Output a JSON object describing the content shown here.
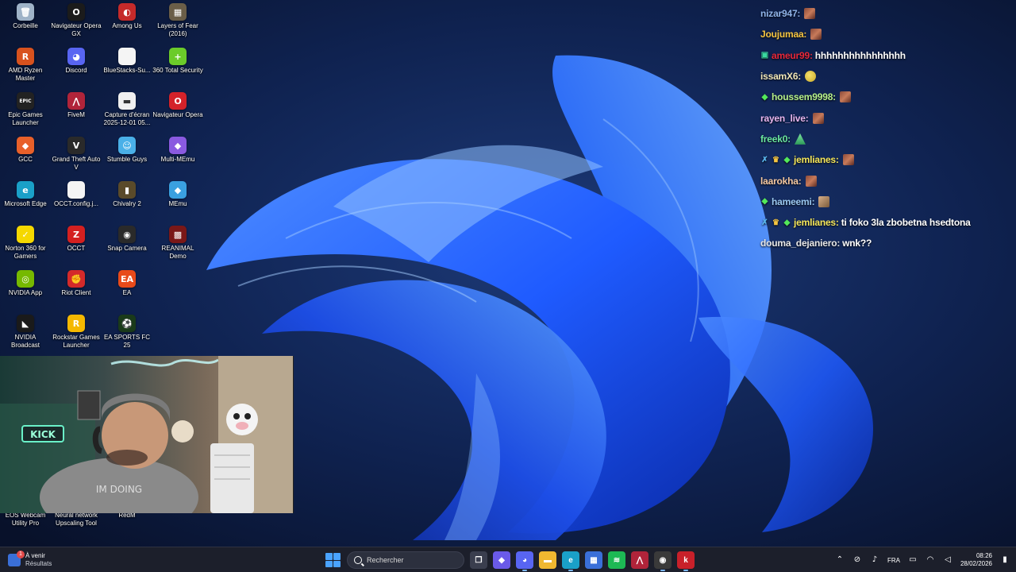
{
  "desktop_icons": [
    {
      "label": "Corbeille",
      "icon": "recycle-bin-icon",
      "color": "#9fb3c8",
      "glyph": "🗑"
    },
    {
      "label": "Navigateur Opera GX",
      "icon": "opera-gx-icon",
      "color": "#1b1b1b",
      "glyph": "O"
    },
    {
      "label": "Among Us",
      "icon": "among-us-icon",
      "color": "#c52a2a",
      "glyph": "◐"
    },
    {
      "label": "Layers of Fear (2016)",
      "icon": "layers-of-fear-icon",
      "color": "#6b5e48",
      "glyph": "▦"
    },
    {
      "label": "AMD Ryzen Master",
      "icon": "amd-ryzen-master-icon",
      "color": "#d8521e",
      "glyph": "R"
    },
    {
      "label": "Discord",
      "icon": "discord-icon",
      "color": "#5865f2",
      "glyph": "◕"
    },
    {
      "label": "BlueStacks-Su...",
      "icon": "file-icon",
      "color": "#f4f4f4",
      "glyph": ""
    },
    {
      "label": "360 Total Security",
      "icon": "360-total-security-icon",
      "color": "#6bcb2a",
      "glyph": "+"
    },
    {
      "label": "Epic Games Launcher",
      "icon": "epic-games-icon",
      "color": "#222222",
      "glyph": "EPIC"
    },
    {
      "label": "FiveM",
      "icon": "fivem-icon",
      "color": "#b0243a",
      "glyph": "⋀"
    },
    {
      "label": "Capture d'écran 2025-12-01 05...",
      "icon": "screenshot-file-icon",
      "color": "#f0f0f0",
      "glyph": "▬"
    },
    {
      "label": "Navigateur Opera",
      "icon": "opera-icon",
      "color": "#d4222a",
      "glyph": "O"
    },
    {
      "label": "GCC",
      "icon": "gcc-icon",
      "color": "#e8602a",
      "glyph": "◆"
    },
    {
      "label": "Grand Theft Auto V",
      "icon": "gta-v-icon",
      "color": "#2a2a2a",
      "glyph": "V"
    },
    {
      "label": "Stumble Guys",
      "icon": "stumble-guys-icon",
      "color": "#4ab0e8",
      "glyph": "☺"
    },
    {
      "label": "Multi-MEmu",
      "icon": "multi-memu-icon",
      "color": "#8a5ae0",
      "glyph": "◆"
    },
    {
      "label": "Microsoft Edge",
      "icon": "microsoft-edge-icon",
      "color": "#1aa0c8",
      "glyph": "e"
    },
    {
      "label": "OCCT.config.j...",
      "icon": "file-icon",
      "color": "#f4f4f4",
      "glyph": ""
    },
    {
      "label": "Chivalry 2",
      "icon": "chivalry-2-icon",
      "color": "#5a4a2a",
      "glyph": "▮"
    },
    {
      "label": "MEmu",
      "icon": "memu-icon",
      "color": "#3aa0e0",
      "glyph": "◆"
    },
    {
      "label": "Norton 360 for Gamers",
      "icon": "norton-icon",
      "color": "#f5d800",
      "glyph": "✓"
    },
    {
      "label": "OCCT",
      "icon": "occt-icon",
      "color": "#d42020",
      "glyph": "Z"
    },
    {
      "label": "Snap Camera",
      "icon": "snap-camera-icon",
      "color": "#2a2a2a",
      "glyph": "◉"
    },
    {
      "label": "REANIMAL Demo",
      "icon": "reanimal-icon",
      "color": "#7a1818",
      "glyph": "▩"
    },
    {
      "label": "NVIDIA App",
      "icon": "nvidia-app-icon",
      "color": "#76b900",
      "glyph": "◎"
    },
    {
      "label": "Riot Client",
      "icon": "riot-client-icon",
      "color": "#d42a2a",
      "glyph": "✊"
    },
    {
      "label": "EA",
      "icon": "ea-icon",
      "color": "#e84a1a",
      "glyph": "EA"
    },
    {
      "label": "",
      "icon": "",
      "color": "",
      "glyph": ""
    },
    {
      "label": "NVIDIA Broadcast",
      "icon": "nvidia-broadcast-icon",
      "color": "#1a1a1a",
      "glyph": "◣"
    },
    {
      "label": "Rockstar Games Launcher",
      "icon": "rockstar-icon",
      "color": "#f5b800",
      "glyph": "R"
    },
    {
      "label": "EA SPORTS FC 25",
      "icon": "ea-sports-fc-icon",
      "color": "#1a3a1a",
      "glyph": "⚽"
    }
  ],
  "bottom_icons": [
    {
      "label": "EOS Webcam Utility Pro",
      "icon": "eos-webcam-icon"
    },
    {
      "label": "Neural network Upscaling Tool",
      "icon": "neural-upscaling-icon"
    },
    {
      "label": "RedM",
      "icon": "redm-icon"
    }
  ],
  "chat": [
    {
      "user": "nizar947:",
      "user_color": "#8fb3e8",
      "badges": [],
      "msg": "",
      "emote": "pixel"
    },
    {
      "user": "Joujumaa:",
      "user_color": "#f5c542",
      "badges": [],
      "msg": "",
      "emote": "pixel"
    },
    {
      "user": "ameur99:",
      "user_color": "#e8283a",
      "badges": [
        "▣"
      ],
      "badge_color": "#3ad8a0",
      "msg": "hhhhhhhhhhhhhhhh",
      "emote": ""
    },
    {
      "user": "issamX6:",
      "user_color": "#f0e6b8",
      "badges": [],
      "msg": "",
      "emote": "pepe"
    },
    {
      "user": "houssem9998:",
      "user_color": "#b6f08a",
      "badges": [
        "◆"
      ],
      "badge_color": "#53e85a",
      "msg": "",
      "emote": "pixel"
    },
    {
      "user": "rayen_live:",
      "user_color": "#e8b6f0",
      "badges": [],
      "msg": "",
      "emote": "pixel"
    },
    {
      "user": "freek0:",
      "user_color": "#6be8a0",
      "badges": [],
      "msg": "",
      "emote": "tree"
    },
    {
      "user": "jemlianes:",
      "user_color": "#f5e65a",
      "badges": [
        "✗",
        "♛",
        "◆"
      ],
      "badge_color": "#5ab8f0",
      "msg": "",
      "emote": "pixel"
    },
    {
      "user": "laarokha:",
      "user_color": "#f5c8a0",
      "badges": [],
      "msg": "",
      "emote": "pixel"
    },
    {
      "user": "hameemi:",
      "user_color": "#9ac8f0",
      "badges": [
        "◆"
      ],
      "badge_color": "#53e85a",
      "msg": "",
      "emote": "man"
    },
    {
      "user": "jemlianes:",
      "user_color": "#f5e65a",
      "badges": [
        "✗",
        "♛",
        "◆"
      ],
      "badge_color": "#5ab8f0",
      "msg": "ti foko 3la zbobetna hsedtona",
      "emote": ""
    },
    {
      "user": "douma_dejaniero:",
      "user_color": "#e8e8e8",
      "badges": [],
      "msg": "wnk??",
      "emote": ""
    }
  ],
  "taskbar": {
    "news_title": "À venir",
    "news_sub": "Résultats",
    "news_badge": "1",
    "search_placeholder": "Rechercher",
    "apps": [
      {
        "name": "task-view-icon",
        "glyph": "❐",
        "color": "#3a3e4e",
        "active": false
      },
      {
        "name": "copilot-icon",
        "glyph": "◆",
        "color": "#6a5ae8",
        "active": false
      },
      {
        "name": "discord-taskbar-icon",
        "glyph": "◕",
        "color": "#5865f2",
        "active": true
      },
      {
        "name": "file-explorer-icon",
        "glyph": "▬",
        "color": "#f0b830",
        "active": false
      },
      {
        "name": "edge-taskbar-icon",
        "glyph": "e",
        "color": "#1aa0c8",
        "active": true
      },
      {
        "name": "microsoft-store-icon",
        "glyph": "▦",
        "color": "#3a6fd8",
        "active": false
      },
      {
        "name": "spotify-icon",
        "glyph": "≋",
        "color": "#1db954",
        "active": false
      },
      {
        "name": "fivem-taskbar-icon",
        "glyph": "⋀",
        "color": "#b0243a",
        "active": false
      },
      {
        "name": "obs-icon",
        "glyph": "◉",
        "color": "#3a3a3a",
        "active": true
      },
      {
        "name": "kick-icon",
        "glyph": "k",
        "color": "#c8202a",
        "active": true
      }
    ],
    "tray_lang": "FRA",
    "time": "08:26",
    "date": "28/02/2026"
  }
}
